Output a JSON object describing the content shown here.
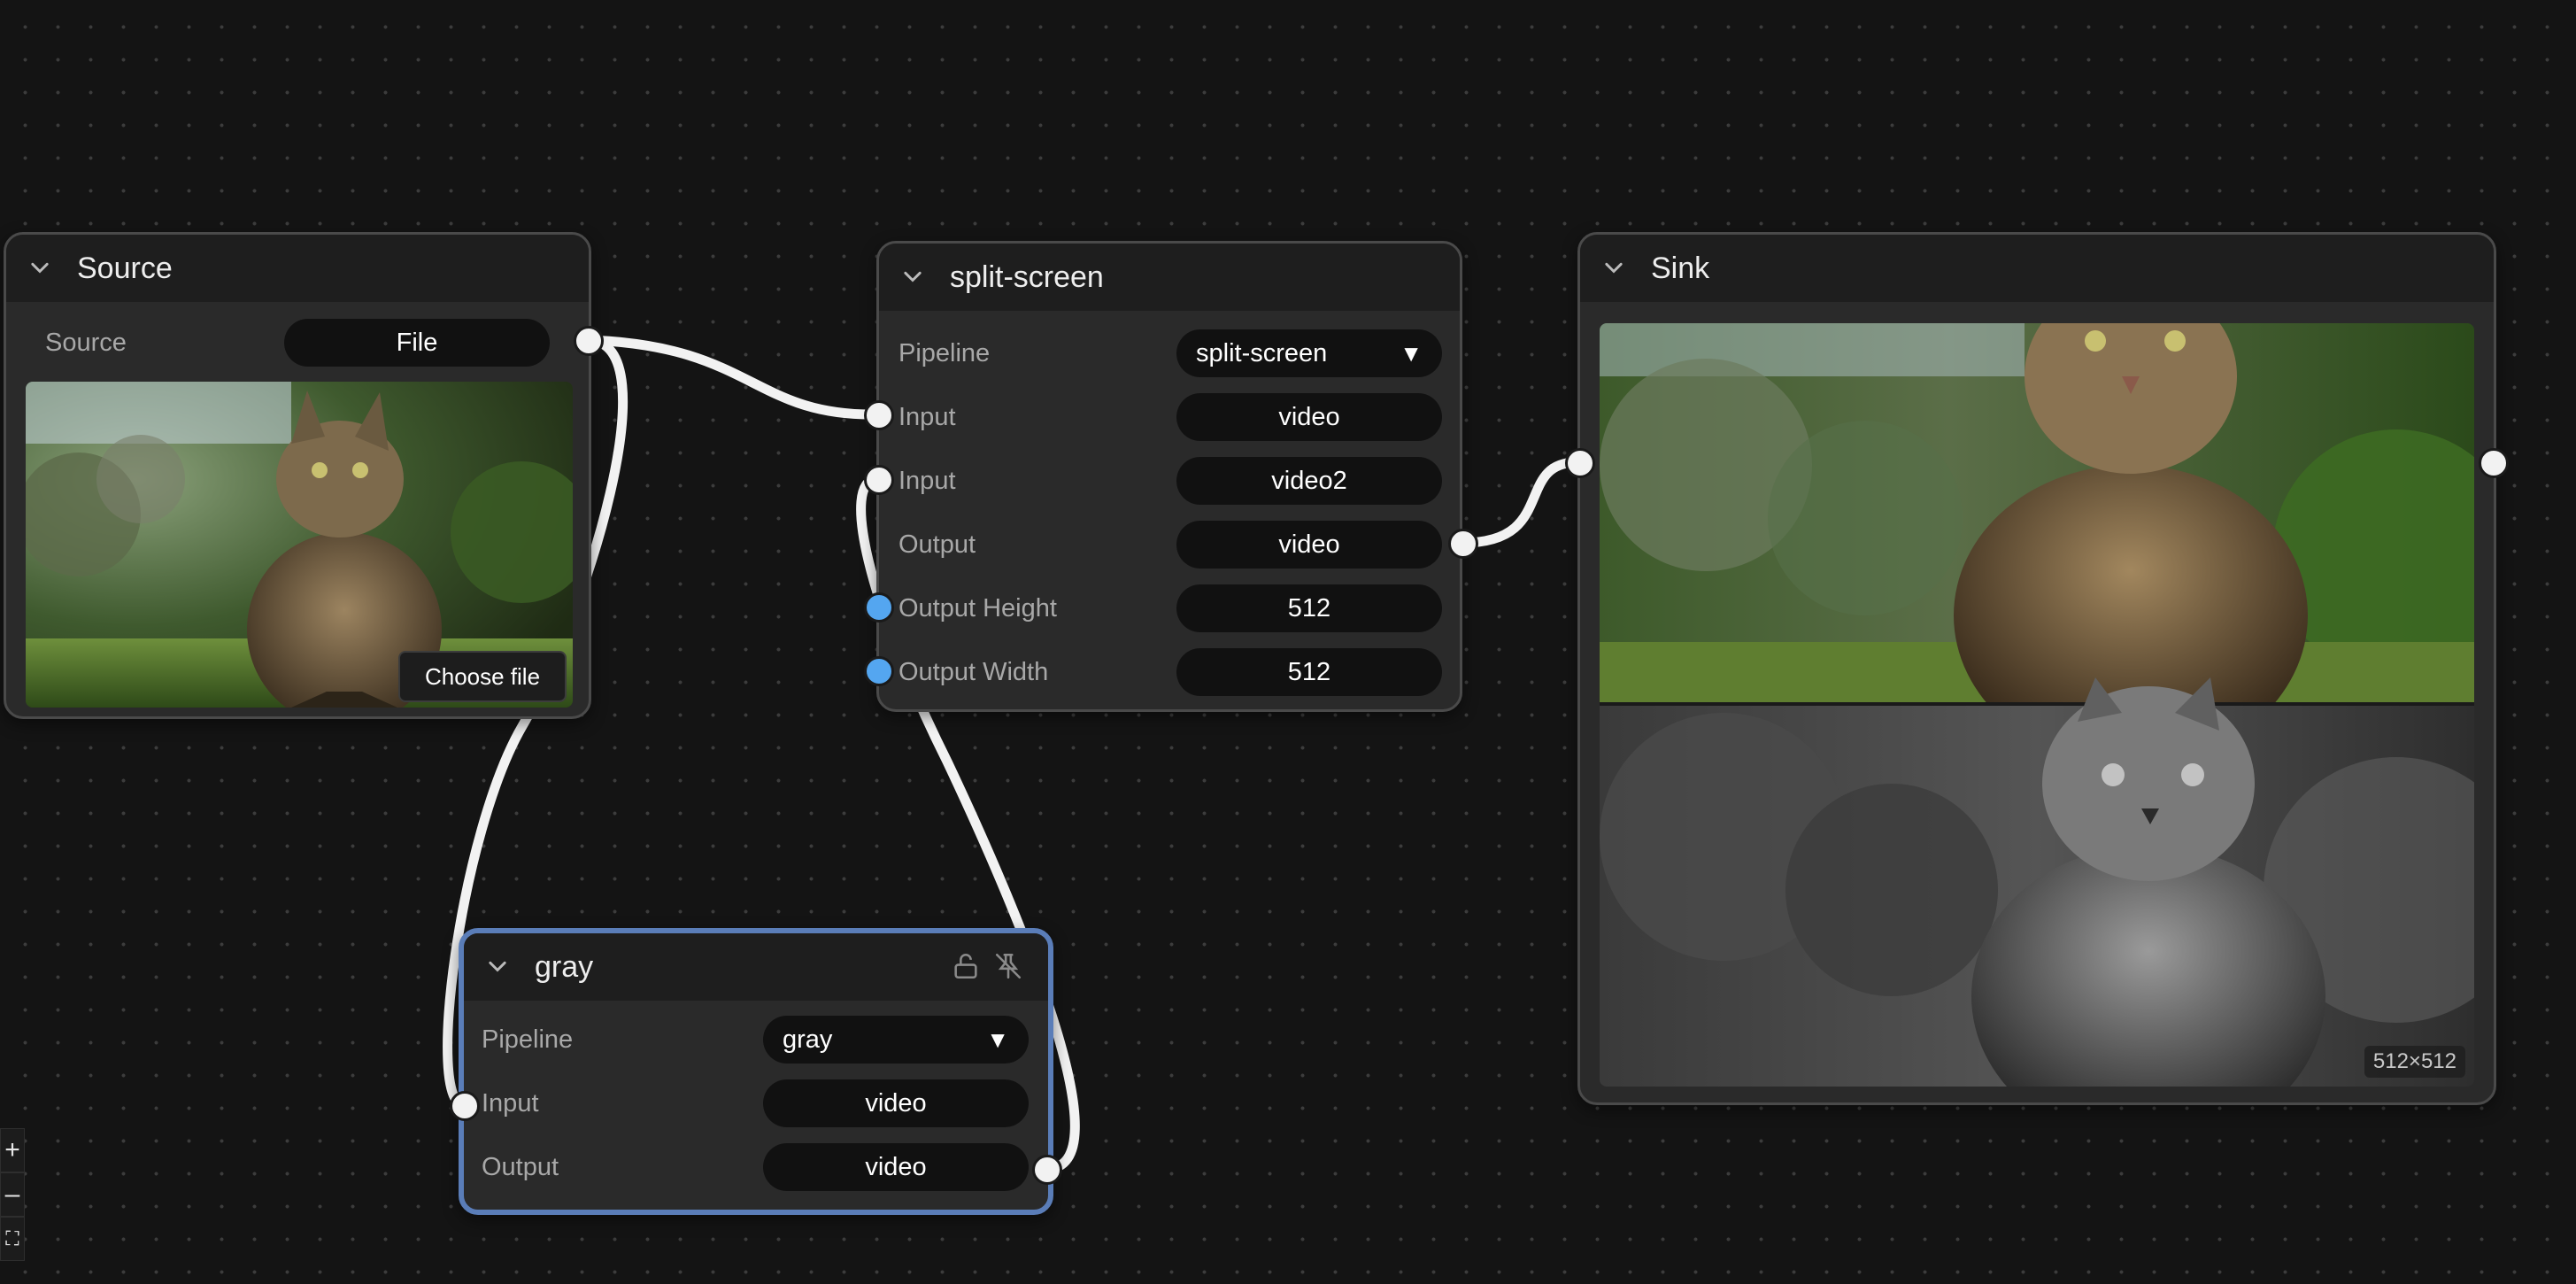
{
  "nodes": {
    "source": {
      "title": "Source",
      "source_label": "Source",
      "source_value": "File",
      "choose_file_label": "Choose file"
    },
    "split": {
      "title": "split-screen",
      "pipeline_label": "Pipeline",
      "pipeline_value": "split-screen",
      "input1_label": "Input",
      "input1_value": "video",
      "input2_label": "Input",
      "input2_value": "video2",
      "output_label": "Output",
      "output_value": "video",
      "height_label": "Output Height",
      "height_value": "512",
      "width_label": "Output Width",
      "width_value": "512"
    },
    "sink": {
      "title": "Sink",
      "resolution": "512×512"
    },
    "gray": {
      "title": "gray",
      "pipeline_label": "Pipeline",
      "pipeline_value": "gray",
      "input_label": "Input",
      "input_value": "video",
      "output_label": "Output",
      "output_value": "video"
    }
  },
  "select_caret": "▼",
  "zoom": {
    "zoom_in": "+",
    "zoom_out": "–",
    "fit": "⛶"
  },
  "colors": {
    "canvas": "#141414",
    "node_bg": "#2a2a2a",
    "selected_border": "#5a7db8",
    "blue_handle": "#54a6f0",
    "edge": "#f2f2f2"
  },
  "icons": [
    "chevron-down-icon",
    "lock-open-icon",
    "pin-off-icon",
    "zoom-in-icon",
    "zoom-out-icon",
    "fit-view-icon"
  ]
}
